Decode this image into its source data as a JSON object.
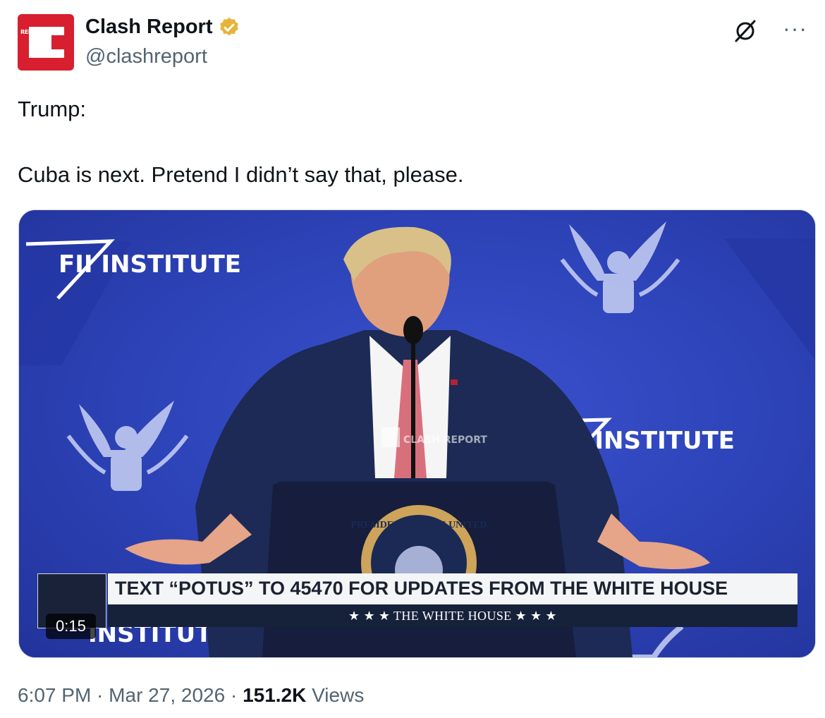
{
  "account": {
    "display_name": "Clash Report",
    "handle": "@clashreport",
    "avatar_text_line1": "CLASH",
    "avatar_text_line2": "REPORT",
    "verified_badge_color": "#e8b33b",
    "avatar_color": "#d81f2f"
  },
  "tweet": {
    "line1": "Trump:",
    "line2": "Cuba is next. Pretend I didn’t say that, please."
  },
  "media": {
    "duration": "0:15",
    "background_text_1": "FII INSTITUTE",
    "background_text_2": "FII INSTITUTE",
    "background_text_3": "INSTITUTE",
    "watermark": "CLASH REPORT",
    "seal_text": "PRESIDENT OF THE UNITED",
    "lower_third_headline": "TEXT “POTUS” TO 45470 FOR UPDATES FROM THE WHITE HOUSE",
    "lower_third_sub": "★ ★ ★   THE WHITE HOUSE   ★ ★ ★",
    "background_color": "#2c42b6"
  },
  "meta": {
    "time": "6:07 PM",
    "separator": " · ",
    "date": "Mar 27, 2026",
    "views_count": "151.2K",
    "views_label": "Views"
  },
  "icons": {
    "grok": "grok-icon",
    "more": "more-options-icon",
    "verified": "verified-badge-icon"
  }
}
